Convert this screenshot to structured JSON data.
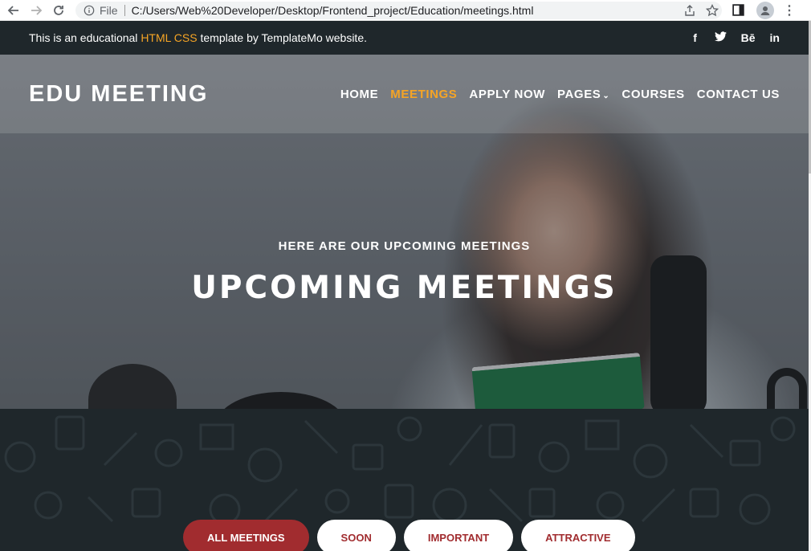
{
  "browser": {
    "file_label": "File",
    "url": "C:/Users/Web%20Developer/Desktop/Frontend_project/Education/meetings.html"
  },
  "topbar": {
    "text_before": "This is an educational ",
    "text_accent": "HTML CSS",
    "text_after": " template by TemplateMo website.",
    "accent_color": "#f5a425",
    "socials": [
      "f",
      "𝐿",
      "Bē",
      "in"
    ]
  },
  "header": {
    "logo": "EDU MEETING",
    "menu": [
      {
        "label": "HOME"
      },
      {
        "label": "MEETINGS"
      },
      {
        "label": "APPLY NOW"
      },
      {
        "label": "PAGES"
      },
      {
        "label": "COURSES"
      },
      {
        "label": "CONTACT US"
      }
    ],
    "active_color": "#f5a425"
  },
  "hero": {
    "subtitle": "HERE ARE OUR UPCOMING MEETINGS",
    "title": "UPCOMING MEETINGS"
  },
  "filters": [
    {
      "label": "ALL MEETINGS"
    },
    {
      "label": "SOON"
    },
    {
      "label": "IMPORTANT"
    },
    {
      "label": "ATTRACTIVE"
    }
  ],
  "colors": {
    "dark_bg": "#1f272b",
    "filter_red": "#a12c2f"
  }
}
